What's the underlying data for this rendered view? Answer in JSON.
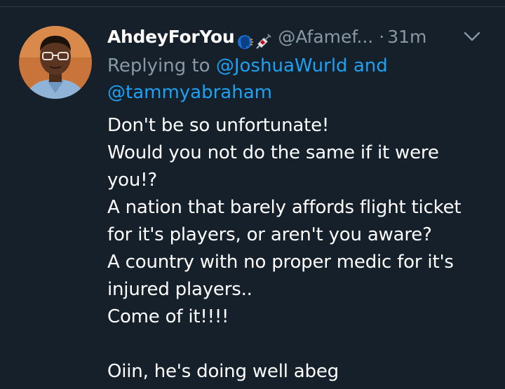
{
  "author": {
    "display_name": "AhdeyForYou",
    "handle": "@Afamef...",
    "separator": "·",
    "timestamp": "31m",
    "name_emojis": [
      "speaking-head-emoji",
      "syringe-emoji"
    ]
  },
  "reply_context": {
    "prefix": "Replying to",
    "mention_1": "@JoshuaWurld",
    "conjunction": "and",
    "mention_2": "@tammyabraham"
  },
  "tweet": {
    "lines": [
      "Don't be so unfortunate!",
      "Would you not do the same if it were",
      "you!?",
      "A nation that barely affords flight ticket",
      "for it's players, or aren't you aware?",
      "A country with no proper medic for it's",
      "injured players..",
      "Come of it!!!!",
      "",
      "Oiin, he's doing well abeg"
    ]
  },
  "icons": {
    "more": "chevron-down-icon",
    "avatar": "user-avatar"
  },
  "colors": {
    "background": "#15202b",
    "primary_text": "#ffffff",
    "secondary_text": "#8899a6",
    "link": "#1da1f2"
  }
}
